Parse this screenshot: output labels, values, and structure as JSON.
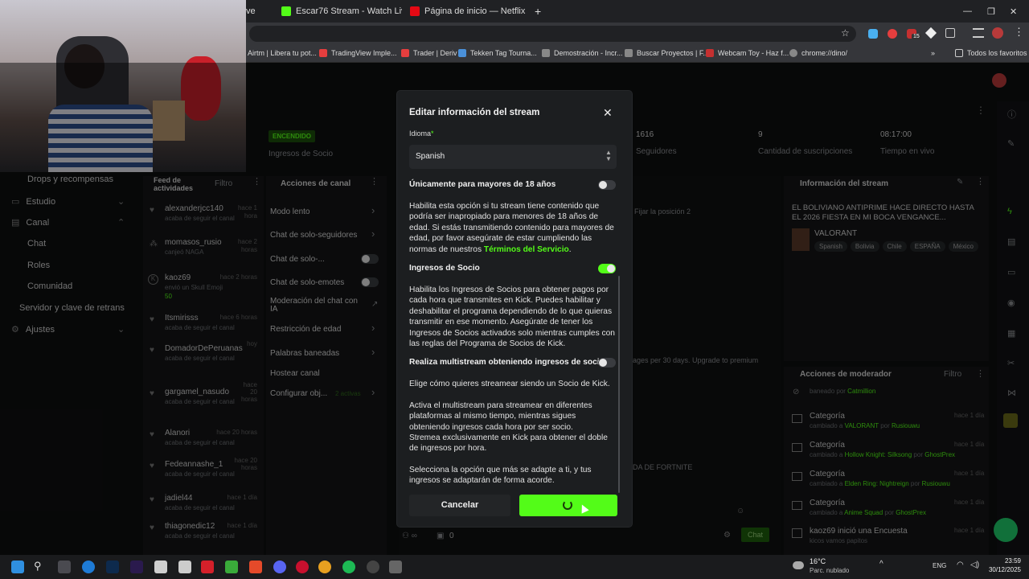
{
  "browser": {
    "tabs": [
      {
        "label": "ve",
        "favicon_color": "#4285f4"
      },
      {
        "label": "Escar76 Stream - Watch Live on",
        "favicon_color": "#53fc18"
      },
      {
        "label": "Página de inicio — Netflix",
        "favicon_color": "#e50914"
      }
    ],
    "new_tab": "+",
    "bookmarks": [
      {
        "label": "Airtm | Libera tu pot...",
        "color": "#2b6cb0"
      },
      {
        "label": "TradingView Imple...",
        "color": "#e53e3e"
      },
      {
        "label": "Trader | Deriv",
        "color": "#e53e3e"
      },
      {
        "label": "Tekken Tag Tourna...",
        "color": "#4a90d9"
      },
      {
        "label": "Demostración - Incr...",
        "color": "#777777"
      },
      {
        "label": "Buscar Proyectos | F...",
        "color": "#777777"
      },
      {
        "label": "Webcam Toy - Haz f...",
        "color": "#c53030"
      },
      {
        "label": "chrome://dino/",
        "color": "#888888"
      }
    ],
    "all_bookmarks": "Todos los favoritos"
  },
  "dashboard": {
    "status_badge": "ENCENDIDO",
    "stats": [
      {
        "value": "",
        "label": "Ingresos de Socio"
      },
      {
        "value": "1616",
        "label": "Seguidores"
      },
      {
        "value": "9",
        "label": "Cantidad de suscripciones"
      },
      {
        "value": "08:17:00",
        "label": "Tiempo en vivo"
      }
    ],
    "sidebar": [
      {
        "label": "Drops y recompensas"
      },
      {
        "label": "Estudio"
      },
      {
        "label": "Canal"
      },
      {
        "label": "Chat"
      },
      {
        "label": "Roles"
      },
      {
        "label": "Comunidad"
      },
      {
        "label": "Servidor y clave de retrans"
      },
      {
        "label": "Ajustes"
      }
    ],
    "feed": {
      "title": "Feed de actividades",
      "filter": "Filtro",
      "items": [
        {
          "user": "alexanderjcc140",
          "time": "hace 1 hora",
          "sub": "acaba de seguir el canal"
        },
        {
          "user": "momasos_rusio",
          "time": "hace 2 horas",
          "sub": "canjeó NAGA"
        },
        {
          "user": "kaoz69",
          "time": "hace 2 horas",
          "sub": "envió un Skull Emoji",
          "extra": "50"
        },
        {
          "user": "Itsmirisss",
          "time": "hace 6 horas",
          "sub": "acaba de seguir el canal"
        },
        {
          "user": "DomadorDePeruanas",
          "time": "hoy",
          "sub": "acaba de seguir el canal"
        },
        {
          "user": "gargamel_nasudo",
          "time": "hace 20 horas",
          "sub": "acaba de seguir el canal"
        },
        {
          "user": "Alanori",
          "time": "hace 20 horas",
          "sub": "acaba de seguir el canal"
        },
        {
          "user": "Fedeannashe_1",
          "time": "hace 20 horas",
          "sub": "acaba de seguir el canal"
        },
        {
          "user": "jadiel44",
          "time": "hace 1 día",
          "sub": "acaba de seguir el canal"
        },
        {
          "user": "thiagonedic12",
          "time": "hace 1 día",
          "sub": "acaba de seguir el canal"
        }
      ]
    },
    "channel_actions": {
      "title": "Acciones de canal",
      "items": [
        {
          "label": "Modo lento"
        },
        {
          "label": "Chat de solo-seguidores"
        },
        {
          "label": "Chat de solo-..."
        },
        {
          "label": "Chat de solo-emotes"
        },
        {
          "label": "Moderación del chat con IA"
        },
        {
          "label": "Restricción de edad"
        },
        {
          "label": "Palabras baneadas"
        },
        {
          "label": "Hostear canal"
        },
        {
          "label": "Configurar obj...",
          "extra": "2 activas"
        }
      ]
    },
    "chat_fragments": {
      "pin": "Fijar la posición 2",
      "limit": "ages per 30 days. Upgrade to premium",
      "game": "DA DE FORTNITE",
      "chat_button": "Chat",
      "count": "0"
    },
    "stream_info": {
      "title": "Información del stream",
      "stream_title": "EL BOLIVIANO ANTIPRIME HACE DIRECTO HASTA EL 2026 FIESTA EN MI BOCA VENGANCE...",
      "category": "VALORANT",
      "tags": [
        "Spanish",
        "Bolivia",
        "Chile",
        "ESPAÑA",
        "México"
      ]
    },
    "mod_actions": {
      "title": "Acciones de moderador",
      "filter": "Filtro",
      "items": [
        {
          "title": "",
          "sub": "baneado por",
          "target": "Catmillion",
          "by": "",
          "time": ""
        },
        {
          "title": "Categoría",
          "sub": "cambiado a",
          "target": "VALORANT",
          "by": "Rusiouwu",
          "time": "hace 1 día"
        },
        {
          "title": "Categoría",
          "sub": "cambiado a",
          "target": "Hollow Knight: Silksong",
          "by": "GhostPrex",
          "time": "hace 1 día"
        },
        {
          "title": "Categoría",
          "sub": "cambiado a",
          "target": "Elden Ring: Nightreign",
          "by": "Rusiouwu",
          "time": "hace 1 día"
        },
        {
          "title": "Categoría",
          "sub": "cambiado a",
          "target": "Anime Squad",
          "by": "GhostPrex",
          "time": "hace 1 día"
        },
        {
          "title": "kaoz69 inició una Encuesta",
          "sub": "kicos vamos papitos",
          "target": "",
          "by": "",
          "time": "hace 1 día"
        }
      ]
    }
  },
  "modal": {
    "title": "Editar información del stream",
    "language_label": "Idioma",
    "language_value": "Spanish",
    "adult_title": "Únicamente para mayores de 18 años",
    "adult_text": "Habilita esta opción si tu stream tiene contenido que podría ser inapropiado para menores de 18 años de edad. Si estás transmitiendo contenido para mayores de edad, por favor asegúrate de estar cumpliendo las normas de nuestros",
    "adult_link": "Términos del Servicio",
    "adult_period": ".",
    "partner_title": "Ingresos de Socio",
    "partner_text": "Habilita los Ingresos de Socios para obtener pagos por cada hora que transmites en Kick. Puedes habilitar y deshabilitar el programa dependiendo de lo que quieras transmitir en ese momento. Asegúrate de tener los Ingresos de Socios activados solo mientras cumples con las reglas del Programa de Socios de Kick.",
    "multi_title": "Realiza multistream obteniendo ingresos de socio",
    "multi_text1": "Elige cómo quieres streamear siendo un Socio de Kick.",
    "multi_text2": "Activa el multistream para streamear en diferentes plataformas al mismo tiempo, mientras sigues obteniendo ingresos cada hora por ser socio.",
    "multi_text3": "Stremea exclusivamente en Kick para obtener el doble de ingresos por hora.",
    "multi_text4": "Selecciona la opción que más se adapte a ti, y tus ingresos se adaptarán de forma acorde.",
    "cancel": "Cancelar",
    "adult_enabled": false,
    "partner_enabled": true,
    "multistream_enabled": false
  },
  "taskbar": {
    "weather_temp": "16°C",
    "weather_desc": "Parc. nublado",
    "lang": "ENG",
    "time": "23:59",
    "date": "30/12/2025",
    "badge": "15"
  },
  "colors": {
    "accent": "#53fc18",
    "bg": "#0e0f10",
    "modal": "#1c1e20"
  }
}
